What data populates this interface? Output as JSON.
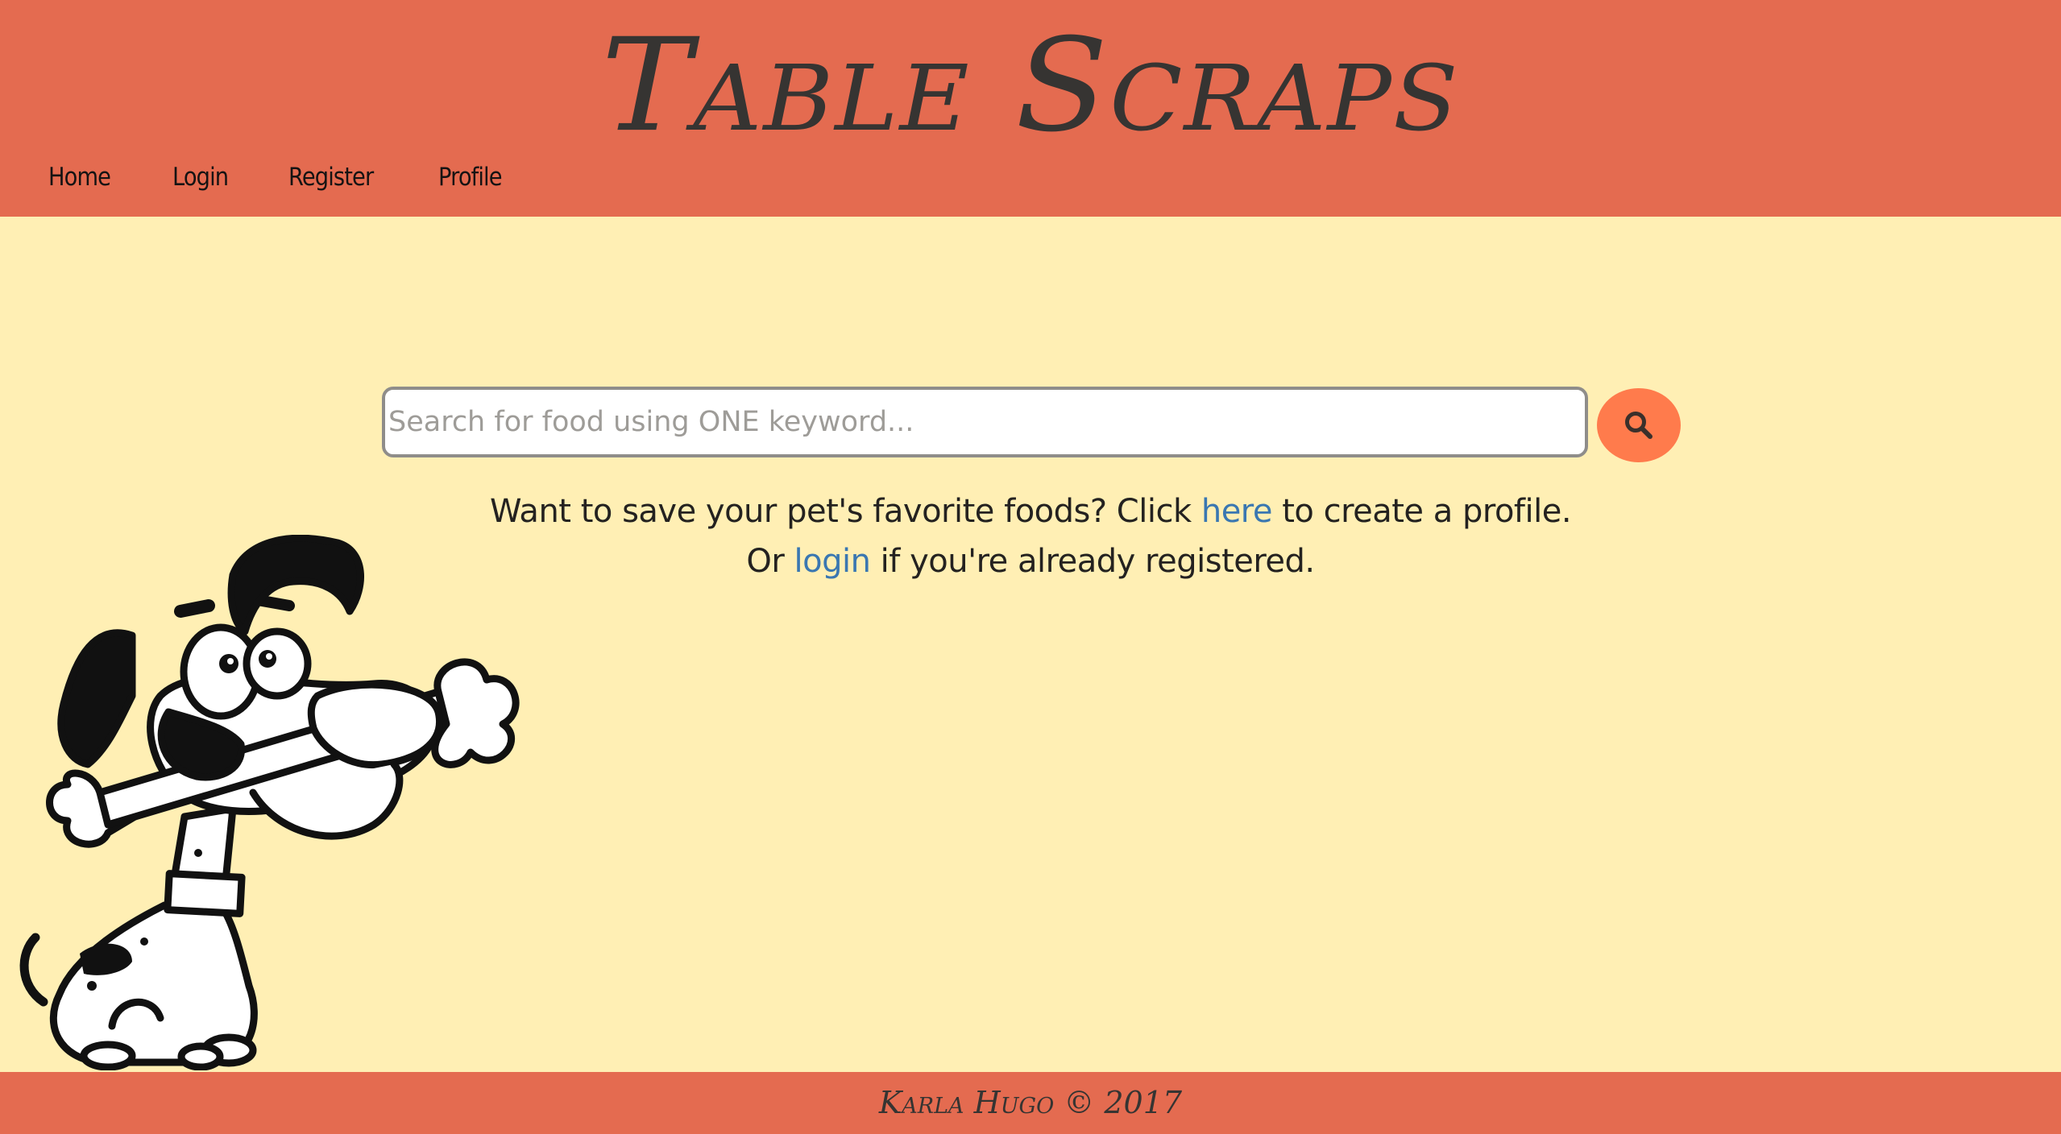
{
  "header": {
    "site_title": "Table Scraps",
    "nav": [
      {
        "label": "Home"
      },
      {
        "label": "Login"
      },
      {
        "label": "Register"
      },
      {
        "label": "Profile"
      }
    ]
  },
  "search": {
    "placeholder": "Search for food using ONE keyword...",
    "value": "",
    "button_icon": "search-icon"
  },
  "message": {
    "line1_before": "Want to save your pet's favorite foods? Click ",
    "line1_link": "here",
    "line1_after": " to create a profile.",
    "line2_before": "Or ",
    "line2_link": "login",
    "line2_after": " if you're already registered."
  },
  "illustration": {
    "icon": "cartoon-dog-with-bone"
  },
  "footer": {
    "text": "Karla Hugo © 2017"
  },
  "colors": {
    "header_bg": "#e46b50",
    "page_bg": "#ffefb4",
    "accent": "#ff7b4c",
    "link": "#3a77b1",
    "text": "#242220"
  }
}
